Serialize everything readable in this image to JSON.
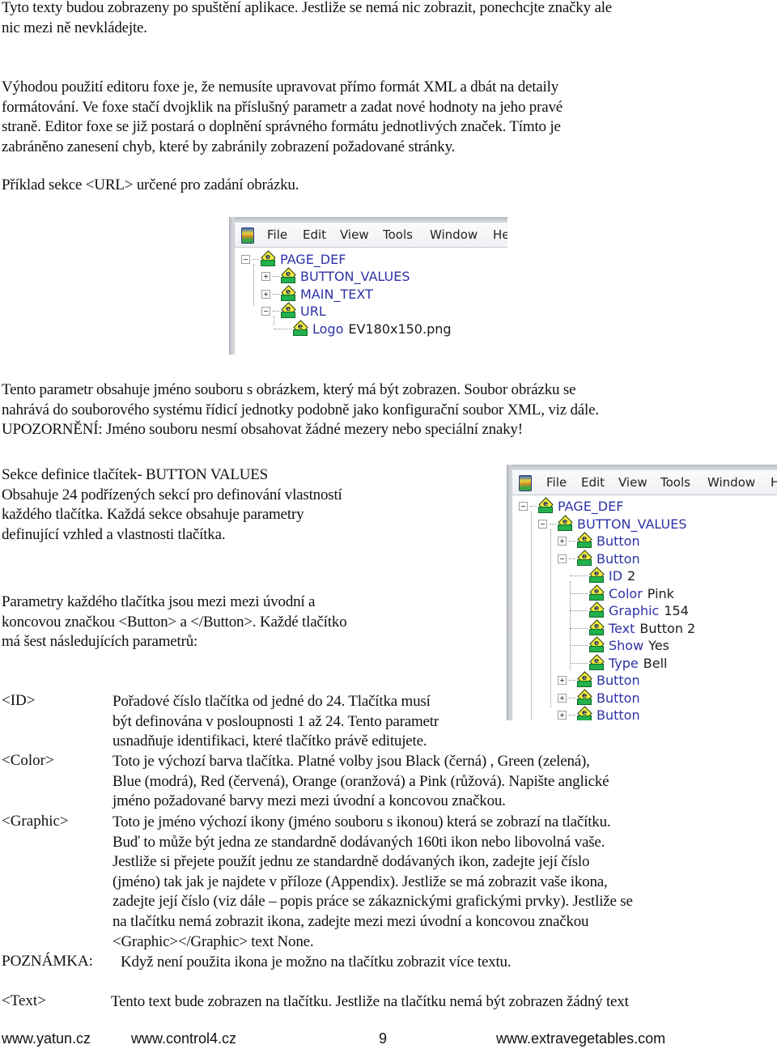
{
  "intro": {
    "lines": [
      "Tyto texty budou zobrazeny po spuštění aplikace. Jestliže se nemá nic zobrazit, ponechcjte značky ale",
      "nic mezi ně nevkládejte."
    ]
  },
  "foxe_advantage": {
    "lines": [
      "Výhodou použití editoru foxe je, že nemusíte upravovat přímo formát XML a dbát na detaily",
      "formátování. Ve foxe stačí dvojklik na příslušný parametr a zadat nové hodnoty na jeho pravé",
      "straně. Editor foxe se již postará o doplnění správného formátu jednotlivých značek. Tímto je",
      "zabráněno zanesení chyb, které by zabránily zobrazení požadované stránky."
    ]
  },
  "url_example_caption": "Příklad sekce <URL> určené pro zadání obrázku.",
  "screenshot1": {
    "menu": [
      "File",
      "Edit",
      "View",
      "Tools",
      "Window",
      "He"
    ],
    "tree": [
      {
        "tag": "PAGE_DEF",
        "value": "",
        "expander": "minus"
      },
      {
        "tag": "BUTTON_VALUES",
        "value": "",
        "expander": "plus"
      },
      {
        "tag": "MAIN_TEXT",
        "value": "",
        "expander": "plus"
      },
      {
        "tag": "URL",
        "value": "",
        "expander": "minus"
      },
      {
        "tag": "Logo",
        "value": "EV180x150.png",
        "expander": "none"
      }
    ]
  },
  "url_description": {
    "lines": [
      "Tento parametr obsahuje jméno souboru s obrázkem, který má být zobrazen. Soubor obrázku se",
      "nahrává do souborového systému řídicí jednotky podobně jako konfigurační soubor XML, viz dále.",
      "UPOZORNĚNÍ: Jméno souboru nesmí obsahovat žádné mezery nebo speciální znaky!"
    ]
  },
  "button_section": {
    "lines": [
      "Sekce definice tlačítek-  BUTTON VALUES",
      "Obsahuje 24 podřízených sekcí pro definování vlastností",
      "každého tlačítka. Každá sekce obsahuje parametry",
      "definující vzhled a vlastnosti tlačítka."
    ]
  },
  "button_params_intro": {
    "lines": [
      "Parametry každého tlačítka jsou mezi mezi úvodní a",
      "koncovou značkou <Button> a </Button>. Každé tlačítko",
      "má šest následujících parametrů:"
    ]
  },
  "screenshot2": {
    "menu": [
      "File",
      "Edit",
      "View",
      "Tools",
      "Window",
      "H"
    ],
    "tree": [
      {
        "tag": "PAGE_DEF",
        "value": "",
        "expander": "minus"
      },
      {
        "tag": "BUTTON_VALUES",
        "value": "",
        "expander": "minus"
      },
      {
        "tag": "Button",
        "value": "",
        "expander": "plus"
      },
      {
        "tag": "Button",
        "value": "",
        "expander": "minus"
      },
      {
        "tag": "ID",
        "value": "2",
        "expander": "none"
      },
      {
        "tag": "Color",
        "value": "Pink",
        "expander": "none"
      },
      {
        "tag": "Graphic",
        "value": "154",
        "expander": "none"
      },
      {
        "tag": "Text",
        "value": "Button 2",
        "expander": "none"
      },
      {
        "tag": "Show",
        "value": "Yes",
        "expander": "none"
      },
      {
        "tag": "Type",
        "value": "Bell",
        "expander": "none"
      },
      {
        "tag": "Button",
        "value": "",
        "expander": "plus"
      },
      {
        "tag": "Button",
        "value": "",
        "expander": "plus"
      },
      {
        "tag": "Button",
        "value": "",
        "expander": "plus"
      }
    ]
  },
  "params": [
    {
      "term": "<ID>",
      "lines": [
        "Pořadové číslo tlačítka od jedné do 24. Tlačítka musí",
        "být definována v posloupnosti 1 až 24. Tento parametr",
        "usnadňuje identifikaci, které tlačítko právě editujete."
      ]
    },
    {
      "term": "<Color>",
      "lines": [
        "Toto je výchozí barva tlačítka. Platné volby jsou  Black (černá) , Green (zelená),",
        "Blue (modrá), Red (červená), Orange (oranžová) a Pink (růžová). Napište anglické",
        "jméno požadované barvy mezi mezi úvodní a koncovou značkou."
      ]
    },
    {
      "term": "<Graphic>",
      "lines": [
        "Toto je jméno výchozí ikony (jméno souboru s ikonou) která se zobrazí na tlačítku.",
        "Buď to může být jedna ze standardně dodávaných 160ti ikon nebo libovolná vaše.",
        "Jestliže si přejete použít jednu ze standardně dodávaných ikon, zadejte její číslo",
        "(jméno) tak jak je najdete v příloze (Appendix). Jestliže se má zobrazit vaše ikona,",
        "zadejte její číslo (viz dále – popis práce se zákaznickými grafickými prvky). Jestliže se",
        "na tlačítku nemá zobrazit ikona, zadejte mezi mezi úvodní a koncovou značkou",
        "<Graphic></Graphic> text None."
      ]
    }
  ],
  "note": {
    "label": "POZNÁMKA:",
    "text": "Když není použita ikona je možno na tlačítku zobrazit více textu."
  },
  "text_param": {
    "term": "<Text>",
    "line": "Tento text bude zobrazen na tlačítku. Jestliže na tlačítku nemá být zobrazen žádný text"
  },
  "footer": {
    "link1": "www.yatun.cz",
    "link2": "www.control4.cz",
    "page_number": "9",
    "link3": "www.extravegetables.com"
  }
}
